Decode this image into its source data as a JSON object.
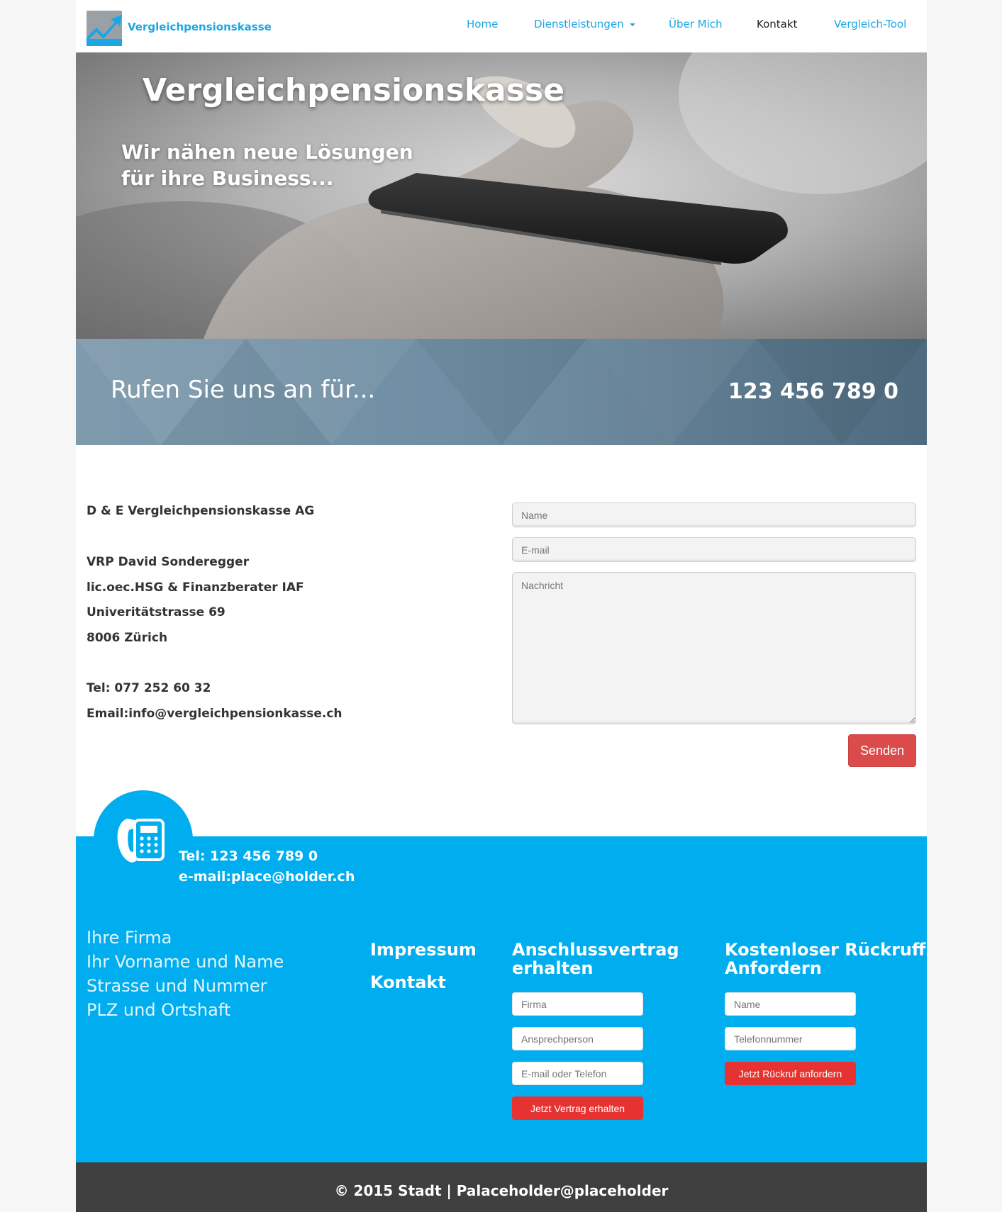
{
  "nav": {
    "brand": "Vergleichpensionskasse",
    "items": [
      {
        "label": "Home"
      },
      {
        "label": "Dienstleistungen"
      },
      {
        "label": "Über Mich"
      },
      {
        "label": "Kontakt"
      },
      {
        "label": "Vergleich-Tool"
      }
    ],
    "active_item": "Kontakt"
  },
  "hero": {
    "title": "Vergleichpensionskasse",
    "subtitle_line1": "Wir nähen neue Lösungen",
    "subtitle_line2": "für ihre Business..."
  },
  "callband": {
    "text": "Rufen Sie uns an für...",
    "number": "123 456 789 0"
  },
  "contact_info": {
    "company": "D & E Vergleichpensionskasse AG",
    "person": "VRP David Sonderegger",
    "title": "lic.oec.HSG & Finanzberater IAF",
    "street": "Univeritätstrasse 69",
    "city": "8006 Zürich",
    "tel": "Tel: 077 252 60 32",
    "email": "Email:info@vergleichpensionkasse.ch"
  },
  "contact_form": {
    "name_placeholder": "Name",
    "email_placeholder": "E-mail",
    "message_placeholder": "Nachricht",
    "send_label": "Senden"
  },
  "footer": {
    "tel": "Tel: 123 456 789 0",
    "email": "e-mail:place@holder.ch",
    "address_lines": [
      "Ihre Firma",
      "Ihr Vorname und Name",
      "Strasse und Nummer",
      "PLZ und Ortshaft"
    ],
    "links": [
      "Impressum",
      "Kontakt"
    ],
    "contract": {
      "heading_line1": "Anschlussvertrag",
      "heading_line2": "erhalten",
      "firma_placeholder": "Firma",
      "person_placeholder": "Ansprechperson",
      "contact_placeholder": "E-mail oder Telefon",
      "button": "Jetzt Vertrag erhalten"
    },
    "callback": {
      "heading_line1": "Kostenloser Rückruff",
      "heading_line2": "Anfordern",
      "name_placeholder": "Name",
      "phone_placeholder": "Telefonnummer",
      "button": "Jetzt Rückruf anfordern"
    },
    "copyright": "© 2015 Stadt | Palaceholder@placeholder"
  },
  "colors": {
    "brand_blue": "#1ba6e5",
    "footer_blue": "#00aeef",
    "send_red": "#dc4b4b",
    "cta_red": "#e63332",
    "footer_dark": "#3f3f3f"
  },
  "icons": [
    "chart-logo-icon",
    "telephone-icon",
    "caret-down-icon",
    "resize-handle-icon"
  ]
}
